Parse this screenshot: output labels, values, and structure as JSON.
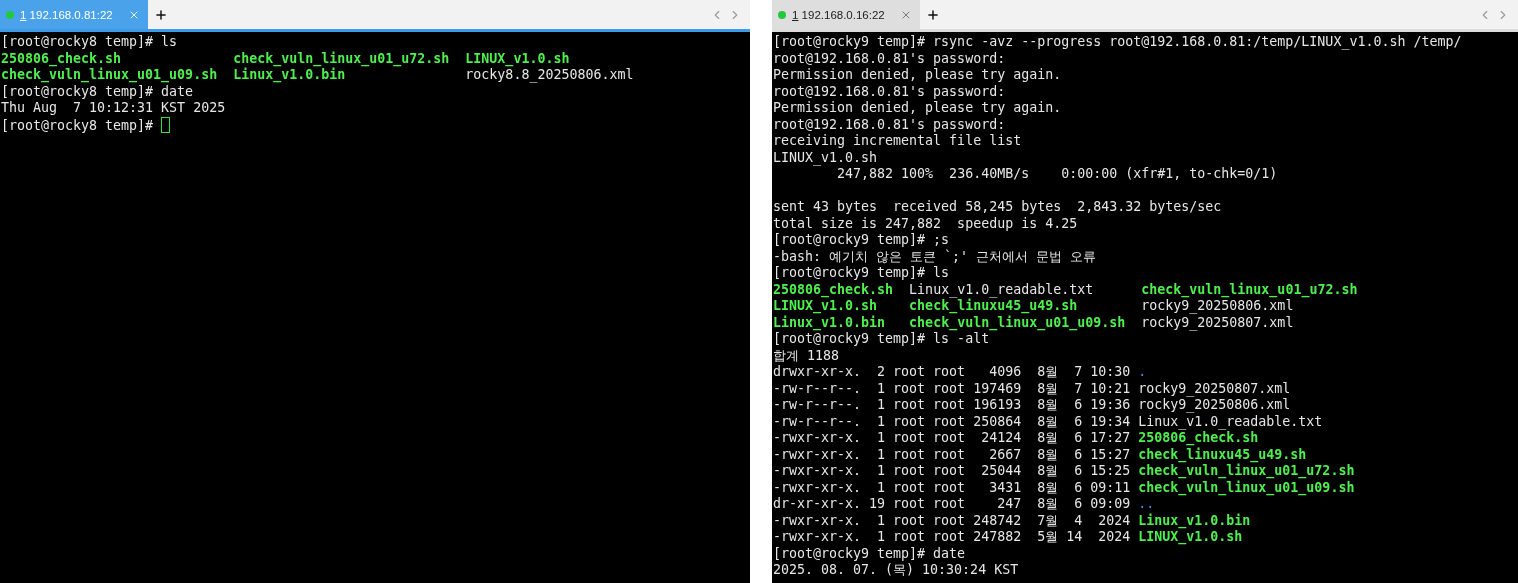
{
  "panes": [
    {
      "tab": {
        "index": "1",
        "host": "192.168.0.81:22",
        "selected": true,
        "connected": true
      },
      "terminal": {
        "cursor": true,
        "lines": [
          {
            "kind": "output",
            "segments": [
              {
                "text": "[root@rocky8 temp]# ls",
                "kind": "plain"
              }
            ]
          },
          {
            "kind": "output",
            "segments": [
              {
                "text": "250806_check.sh              ",
                "kind": "exec"
              },
              {
                "text": "check_vuln_linux_u01_u72.sh  ",
                "kind": "exec"
              },
              {
                "text": "LINUX_v1.0.sh",
                "kind": "exec"
              }
            ]
          },
          {
            "kind": "output",
            "segments": [
              {
                "text": "check_vuln_linux_u01_u09.sh  ",
                "kind": "exec"
              },
              {
                "text": "Linux_v1.0.bin               ",
                "kind": "exec"
              },
              {
                "text": "rocky8.8_20250806.xml",
                "kind": "plain"
              }
            ]
          },
          {
            "kind": "output",
            "segments": [
              {
                "text": "[root@rocky8 temp]# date",
                "kind": "plain"
              }
            ]
          },
          {
            "kind": "output",
            "segments": [
              {
                "text": "Thu Aug  7 10:12:31 KST 2025",
                "kind": "plain"
              }
            ]
          },
          {
            "kind": "output",
            "segments": [
              {
                "text": "[root@rocky8 temp]# ",
                "kind": "plain"
              }
            ]
          }
        ]
      }
    },
    {
      "tab": {
        "index": "1",
        "host": "192.168.0.16:22",
        "selected": false,
        "connected": true
      },
      "terminal": {
        "lines": [
          {
            "kind": "output",
            "segments": [
              {
                "text": "[root@rocky9 temp]# rsync -avz --progress root@192.168.0.81:/temp/LINUX_v1.0.sh /temp/",
                "kind": "plain"
              }
            ]
          },
          {
            "kind": "output",
            "segments": [
              {
                "text": "root@192.168.0.81's password:",
                "kind": "plain"
              }
            ]
          },
          {
            "kind": "output",
            "segments": [
              {
                "text": "Permission denied, please try again.",
                "kind": "plain"
              }
            ]
          },
          {
            "kind": "output",
            "segments": [
              {
                "text": "root@192.168.0.81's password:",
                "kind": "plain"
              }
            ]
          },
          {
            "kind": "output",
            "segments": [
              {
                "text": "Permission denied, please try again.",
                "kind": "plain"
              }
            ]
          },
          {
            "kind": "output",
            "segments": [
              {
                "text": "root@192.168.0.81's password:",
                "kind": "plain"
              }
            ]
          },
          {
            "kind": "output",
            "segments": [
              {
                "text": "receiving incremental file list",
                "kind": "plain"
              }
            ]
          },
          {
            "kind": "output",
            "segments": [
              {
                "text": "LINUX_v1.0.sh",
                "kind": "plain"
              }
            ]
          },
          {
            "kind": "output",
            "segments": [
              {
                "text": "        247,882 100%  236.40MB/s    0:00:00 (xfr#1, to-chk=0/1)",
                "kind": "plain"
              }
            ]
          },
          {
            "kind": "blank"
          },
          {
            "kind": "output",
            "segments": [
              {
                "text": "sent 43 bytes  received 58,245 bytes  2,843.32 bytes/sec",
                "kind": "plain"
              }
            ]
          },
          {
            "kind": "output",
            "segments": [
              {
                "text": "total size is 247,882  speedup is 4.25",
                "kind": "plain"
              }
            ]
          },
          {
            "kind": "output",
            "segments": [
              {
                "text": "[root@rocky9 temp]# ;s",
                "kind": "plain"
              }
            ]
          },
          {
            "kind": "output",
            "segments": [
              {
                "text": "-bash: 예기치 않은 토큰 `;' 근처에서 문법 오류",
                "kind": "plain"
              }
            ]
          },
          {
            "kind": "output",
            "segments": [
              {
                "text": "[root@rocky9 temp]# ls",
                "kind": "plain"
              }
            ]
          },
          {
            "kind": "output",
            "segments": [
              {
                "text": "250806_check.sh  ",
                "kind": "exec"
              },
              {
                "text": "Linux_v1.0_readable.txt      ",
                "kind": "plain"
              },
              {
                "text": "check_vuln_linux_u01_u72.sh",
                "kind": "exec"
              }
            ]
          },
          {
            "kind": "output",
            "segments": [
              {
                "text": "LINUX_v1.0.sh    ",
                "kind": "exec"
              },
              {
                "text": "check_linuxu45_u49.sh        ",
                "kind": "exec"
              },
              {
                "text": "rocky9_20250806.xml",
                "kind": "plain"
              }
            ]
          },
          {
            "kind": "output",
            "segments": [
              {
                "text": "Linux_v1.0.bin   ",
                "kind": "exec"
              },
              {
                "text": "check_vuln_linux_u01_u09.sh  ",
                "kind": "exec"
              },
              {
                "text": "rocky9_20250807.xml",
                "kind": "plain"
              }
            ]
          },
          {
            "kind": "output",
            "segments": [
              {
                "text": "[root@rocky9 temp]# ls -alt",
                "kind": "plain"
              }
            ]
          },
          {
            "kind": "output",
            "segments": [
              {
                "text": "합계 1188",
                "kind": "plain"
              }
            ]
          },
          {
            "kind": "output",
            "segments": [
              {
                "text": "drwxr-xr-x.  2 root root   4096  8월  7 10:30 ",
                "kind": "plain"
              },
              {
                "text": ".",
                "kind": "dir"
              }
            ]
          },
          {
            "kind": "output",
            "segments": [
              {
                "text": "-rw-r--r--.  1 root root 197469  8월  7 10:21 rocky9_20250807.xml",
                "kind": "plain"
              }
            ]
          },
          {
            "kind": "output",
            "segments": [
              {
                "text": "-rw-r--r--.  1 root root 196193  8월  6 19:36 rocky9_20250806.xml",
                "kind": "plain"
              }
            ]
          },
          {
            "kind": "output",
            "segments": [
              {
                "text": "-rw-r--r--.  1 root root 250864  8월  6 19:34 Linux_v1.0_readable.txt",
                "kind": "plain"
              }
            ]
          },
          {
            "kind": "output",
            "segments": [
              {
                "text": "-rwxr-xr-x.  1 root root  24124  8월  6 17:27 ",
                "kind": "plain"
              },
              {
                "text": "250806_check.sh",
                "kind": "exec"
              }
            ]
          },
          {
            "kind": "output",
            "segments": [
              {
                "text": "-rwxr-xr-x.  1 root root   2667  8월  6 15:27 ",
                "kind": "plain"
              },
              {
                "text": "check_linuxu45_u49.sh",
                "kind": "exec"
              }
            ]
          },
          {
            "kind": "output",
            "segments": [
              {
                "text": "-rwxr-xr-x.  1 root root  25044  8월  6 15:25 ",
                "kind": "plain"
              },
              {
                "text": "check_vuln_linux_u01_u72.sh",
                "kind": "exec"
              }
            ]
          },
          {
            "kind": "output",
            "segments": [
              {
                "text": "-rwxr-xr-x.  1 root root   3431  8월  6 09:11 ",
                "kind": "plain"
              },
              {
                "text": "check_vuln_linux_u01_u09.sh",
                "kind": "exec"
              }
            ]
          },
          {
            "kind": "output",
            "segments": [
              {
                "text": "dr-xr-xr-x. 19 root root    247  8월  6 09:09 ",
                "kind": "plain"
              },
              {
                "text": "..",
                "kind": "dir"
              }
            ]
          },
          {
            "kind": "output",
            "segments": [
              {
                "text": "-rwxr-xr-x.  1 root root 248742  7월  4  2024 ",
                "kind": "plain"
              },
              {
                "text": "Linux_v1.0.bin",
                "kind": "exec"
              }
            ]
          },
          {
            "kind": "output",
            "segments": [
              {
                "text": "-rwxr-xr-x.  1 root root 247882  5월 14  2024 ",
                "kind": "plain"
              },
              {
                "text": "LINUX_v1.0.sh",
                "kind": "exec"
              }
            ]
          },
          {
            "kind": "output",
            "segments": [
              {
                "text": "[root@rocky9 temp]# date",
                "kind": "plain"
              }
            ]
          },
          {
            "kind": "output",
            "segments": [
              {
                "text": "2025. 08. 07. (목) 10:30:24 KST",
                "kind": "plain"
              }
            ]
          }
        ]
      }
    }
  ]
}
